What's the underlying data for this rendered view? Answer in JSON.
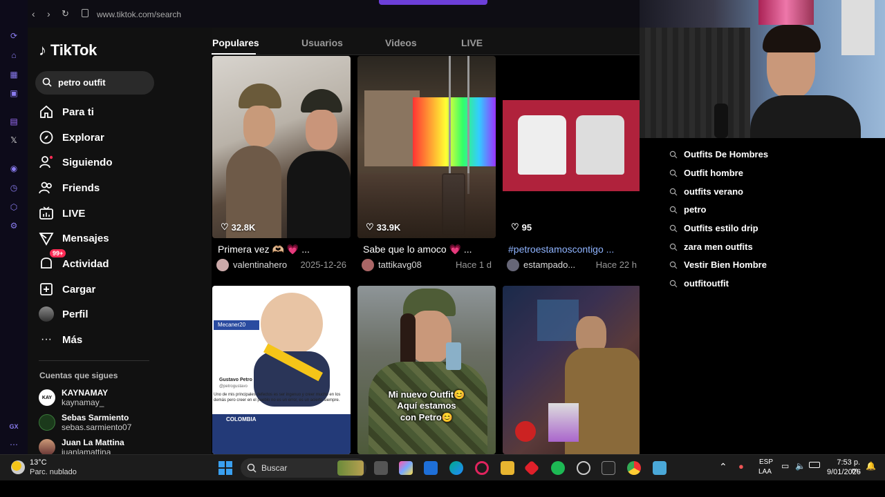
{
  "browser": {
    "url": "www.tiktok.com/search",
    "side_labels": {
      "gx": "GX"
    }
  },
  "app": {
    "name": "TikTok"
  },
  "search": {
    "query": "petro outfit"
  },
  "menu": [
    {
      "label": "Para ti",
      "icon": "home-icon"
    },
    {
      "label": "Explorar",
      "icon": "compass-icon"
    },
    {
      "label": "Siguiendo",
      "icon": "following-icon"
    },
    {
      "label": "Friends",
      "icon": "friends-icon"
    },
    {
      "label": "LIVE",
      "icon": "live-icon"
    },
    {
      "label": "Mensajes",
      "icon": "messages-icon"
    },
    {
      "label": "Actividad",
      "icon": "activity-icon",
      "badge": "99+"
    },
    {
      "label": "Cargar",
      "icon": "upload-icon"
    },
    {
      "label": "Perfil",
      "icon": "profile-icon"
    },
    {
      "label": "Más",
      "icon": "more-icon"
    }
  ],
  "following": {
    "title": "Cuentas que sigues",
    "accounts": [
      {
        "name": "KAYNAMAY",
        "handle": "kaynamay_",
        "avatar_text": "KAY"
      },
      {
        "name": "Sebas Sarmiento",
        "handle": "sebas.sarmiento07"
      },
      {
        "name": "Juan La Mattina",
        "handle": "juanlamattina"
      }
    ]
  },
  "tabs": [
    "Populares",
    "Usuarios",
    "Videos",
    "LIVE"
  ],
  "results": [
    {
      "likes": "32.8K",
      "caption": "Primera vez 🫶🏼 💗 ...",
      "user": "valentinahero",
      "date": "2025-12-26",
      "hashtag": false
    },
    {
      "likes": "33.9K",
      "caption": "Sabe que lo amoco 💗 ...",
      "user": "tattikavg08",
      "date": "Hace 1 d",
      "hashtag": false
    },
    {
      "likes": "95",
      "caption": "#petroestamoscontigo ...",
      "user": "estampado...",
      "date": "Hace 22 h",
      "hashtag": true
    },
    {
      "overlay": ""
    },
    {
      "overlay": "Mi nuevo Outfit😊\nAquí estamos\ncon Petro😊"
    },
    {
      "overlay": ""
    }
  ],
  "thumb2_text": {
    "tag": "Mecaner20",
    "author": "Gustavo Petro",
    "handle": "@petrogustavo",
    "quote": "Uno de mis principales defectos es ser ingenuo y creer mucho en los demás pero creer en el pueblo no es un error, es un acierto siempre.",
    "place": "COLOMBIA"
  },
  "suggestions": [
    "Outfits De Hombres",
    "Outfit hombre",
    "outfits verano",
    "petro",
    "Outfits estilo drip",
    "zara men outfits",
    "Vestir Bien Hombre",
    "outfitoutfit"
  ],
  "taskbar": {
    "temp": "13°C",
    "weather": "Parc. nublado",
    "search": "Buscar",
    "lang1": "ESP",
    "lang2": "LAA",
    "time": "7:53 p. m.",
    "date": "9/01/2026"
  },
  "colors": {
    "accent": "#fe2c55",
    "purple": "#6c3fd8",
    "hashtag": "#8fb4ff"
  }
}
